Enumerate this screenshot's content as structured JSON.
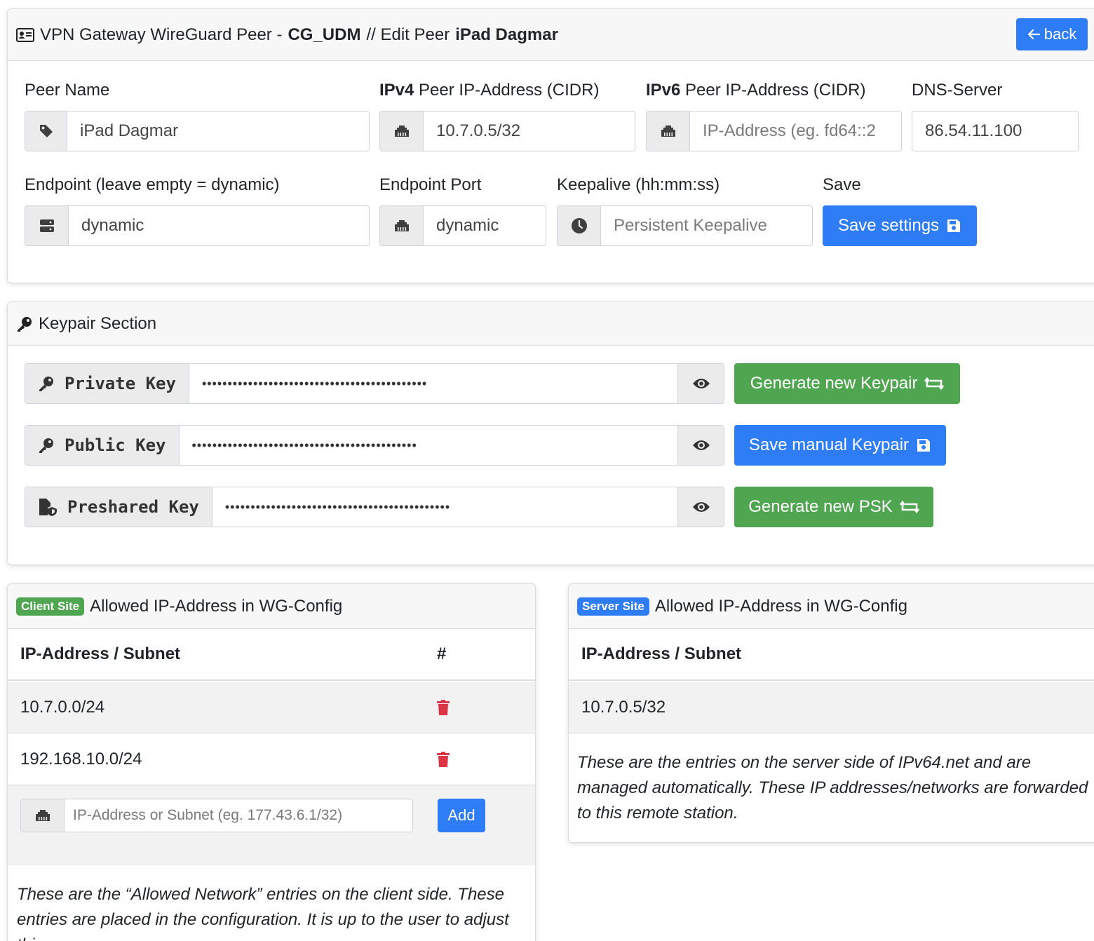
{
  "header": {
    "title_prefix": "VPN Gateway WireGuard Peer -",
    "gateway_name": "CG_UDM",
    "title_middle": "// Edit Peer",
    "peer_name": "iPad Dagmar",
    "back_label": "back",
    "icon": "id-card-icon"
  },
  "peer_form": {
    "peer_name_label": "Peer Name",
    "peer_name_value": "iPad Dagmar",
    "ipv4_label_bold": "IPv4",
    "ipv4_label_rest": "Peer IP-Address (CIDR)",
    "ipv4_value": "10.7.0.5/32",
    "ipv6_label_bold": "IPv6",
    "ipv6_label_rest": "Peer IP-Address (CIDR)",
    "ipv6_placeholder": "IP-Address (eg. fd64::2",
    "dns_label": "DNS-Server",
    "dns_value": "86.54.11.100",
    "endpoint_label": "Endpoint (leave empty = dynamic)",
    "endpoint_value": "dynamic",
    "endpoint_port_label": "Endpoint Port",
    "endpoint_port_value": "dynamic",
    "keepalive_label": "Keepalive (hh:mm:ss)",
    "keepalive_placeholder": "Persistent Keepalive",
    "save_label": "Save",
    "save_button": "Save settings"
  },
  "keypair": {
    "section_title": "Keypair Section",
    "private_key_label": "Private Key",
    "private_key_value": "••••••••••••••••••••••••••••••••••••••••••••",
    "public_key_label": "Public Key",
    "public_key_value": "••••••••••••••••••••••••••••••••••••••••••••",
    "psk_label": "Preshared Key",
    "psk_value": "••••••••••••••••••••••••••••••••••••••••••••",
    "generate_keypair_button": "Generate new Keypair",
    "save_manual_keypair_button": "Save manual Keypair",
    "generate_psk_button": "Generate new PSK"
  },
  "client_site": {
    "badge": "Client Site",
    "title": "Allowed IP-Address in WG-Config",
    "col_ip": "IP-Address / Subnet",
    "col_action": "#",
    "rows": [
      "10.7.0.0/24",
      "192.168.10.0/24"
    ],
    "add_placeholder": "IP-Address or Subnet (eg. 177.43.6.1/32)",
    "add_button": "Add",
    "note": "These are the “Allowed Network” entries on the client side. These entries are placed in the configuration. It is up to the user to adjust this"
  },
  "server_site": {
    "badge": "Server Site",
    "title": "Allowed IP-Address in WG-Config",
    "col_ip": "IP-Address / Subnet",
    "rows": [
      "10.7.0.5/32"
    ],
    "note": "These are the entries on the server side of IPv64.net and are managed automatically. These IP addresses/networks are forwarded to this remote station."
  },
  "colors": {
    "primary": "#2f7df6",
    "success": "#4fa550",
    "danger": "#dc3545"
  }
}
